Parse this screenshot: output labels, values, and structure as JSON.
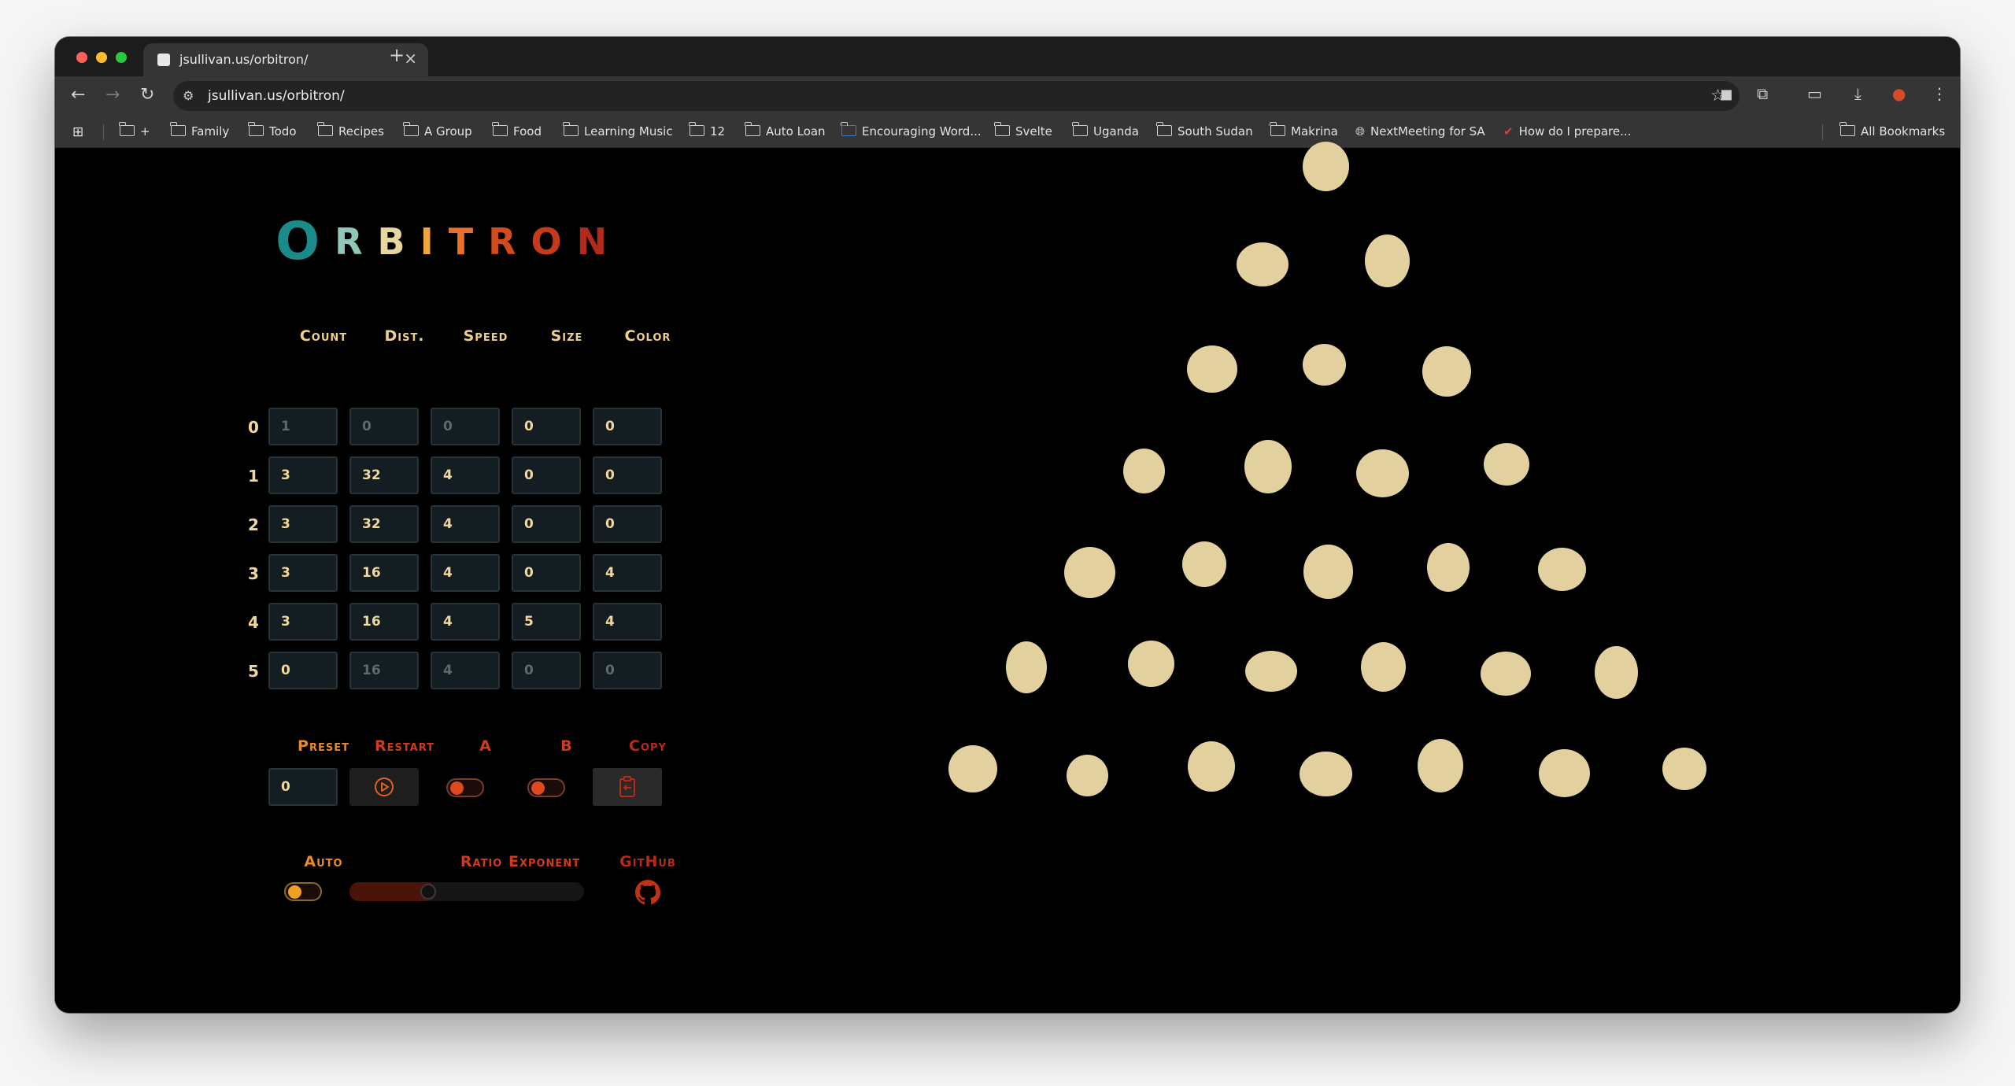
{
  "browser": {
    "tab_title": "jsullivan.us/orbitron/",
    "url": "jsullivan.us/orbitron/",
    "bookmarks": [
      "+",
      "Family",
      "Todo",
      "Recipes",
      "A Group",
      "Food",
      "Learning Music",
      "12",
      "Auto Loan",
      "Encouraging Word...",
      "Svelte",
      "Uganda",
      "South Sudan",
      "Makrina",
      "NextMeeting for SA",
      "How do I prepare..."
    ],
    "all_bookmarks": "All Bookmarks"
  },
  "app": {
    "logo_letters": [
      "O",
      "R",
      "B",
      "I",
      "T",
      "R",
      "O",
      "N"
    ],
    "logo_colors": [
      "#1a8a8a",
      "#8fc7b8",
      "#e8d6a0",
      "#f0a63a",
      "#e8702a",
      "#d24a1e",
      "#c53a1a",
      "#b22a1a"
    ],
    "accent_orange": "#e88a2a",
    "accent_red": "#d23a1a",
    "dot_color": "#e2d19f"
  },
  "table": {
    "headers": [
      "Count",
      "Dist.",
      "Speed",
      "Size",
      "Color"
    ],
    "rows": [
      {
        "label": "0",
        "values": [
          "1",
          "0",
          "0",
          "0",
          "0"
        ],
        "dim": [
          true,
          true,
          true,
          false,
          false
        ]
      },
      {
        "label": "1",
        "values": [
          "3",
          "32",
          "4",
          "0",
          "0"
        ],
        "dim": [
          false,
          false,
          false,
          false,
          false
        ]
      },
      {
        "label": "2",
        "values": [
          "3",
          "32",
          "4",
          "0",
          "0"
        ],
        "dim": [
          false,
          false,
          false,
          false,
          false
        ]
      },
      {
        "label": "3",
        "values": [
          "3",
          "16",
          "4",
          "0",
          "4"
        ],
        "dim": [
          false,
          false,
          false,
          false,
          false
        ]
      },
      {
        "label": "4",
        "values": [
          "3",
          "16",
          "4",
          "5",
          "4"
        ],
        "dim": [
          false,
          false,
          false,
          false,
          false
        ]
      },
      {
        "label": "5",
        "values": [
          "0",
          "16",
          "4",
          "0",
          "0"
        ],
        "dim": [
          false,
          true,
          true,
          true,
          true
        ]
      }
    ]
  },
  "controls": {
    "preset_label": "Preset",
    "preset_value": "0",
    "restart_label": "Restart",
    "a_label": "A",
    "b_label": "B",
    "copy_label": "Copy",
    "auto_label": "Auto",
    "ratio_label": "Ratio Exponent",
    "github_label": "GitHub",
    "ratio_fraction": 0.33,
    "a_on": false,
    "b_on": false,
    "auto_on": false
  }
}
